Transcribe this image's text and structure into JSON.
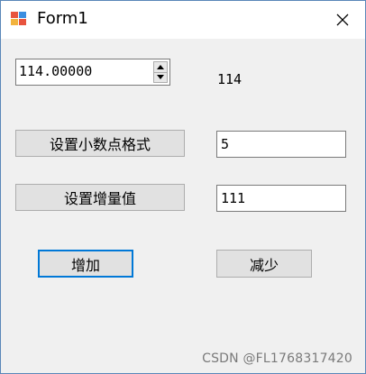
{
  "window": {
    "title": "Form1",
    "icon": "winforms-app-icon",
    "close_icon": "close-icon"
  },
  "numeric_updown": {
    "value": "114.00000"
  },
  "value_label": "114",
  "buttons": {
    "set_decimal": "设置小数点格式",
    "set_increment": "设置增量值",
    "increase": "增加",
    "decrease": "减少"
  },
  "textboxes": {
    "decimal_places": "5",
    "increment": "111"
  },
  "watermark": "CSDN @FL1768317420",
  "colors": {
    "focus_border": "#0078d7",
    "button_bg": "#e1e1e1",
    "form_bg": "#f0f0f0"
  }
}
